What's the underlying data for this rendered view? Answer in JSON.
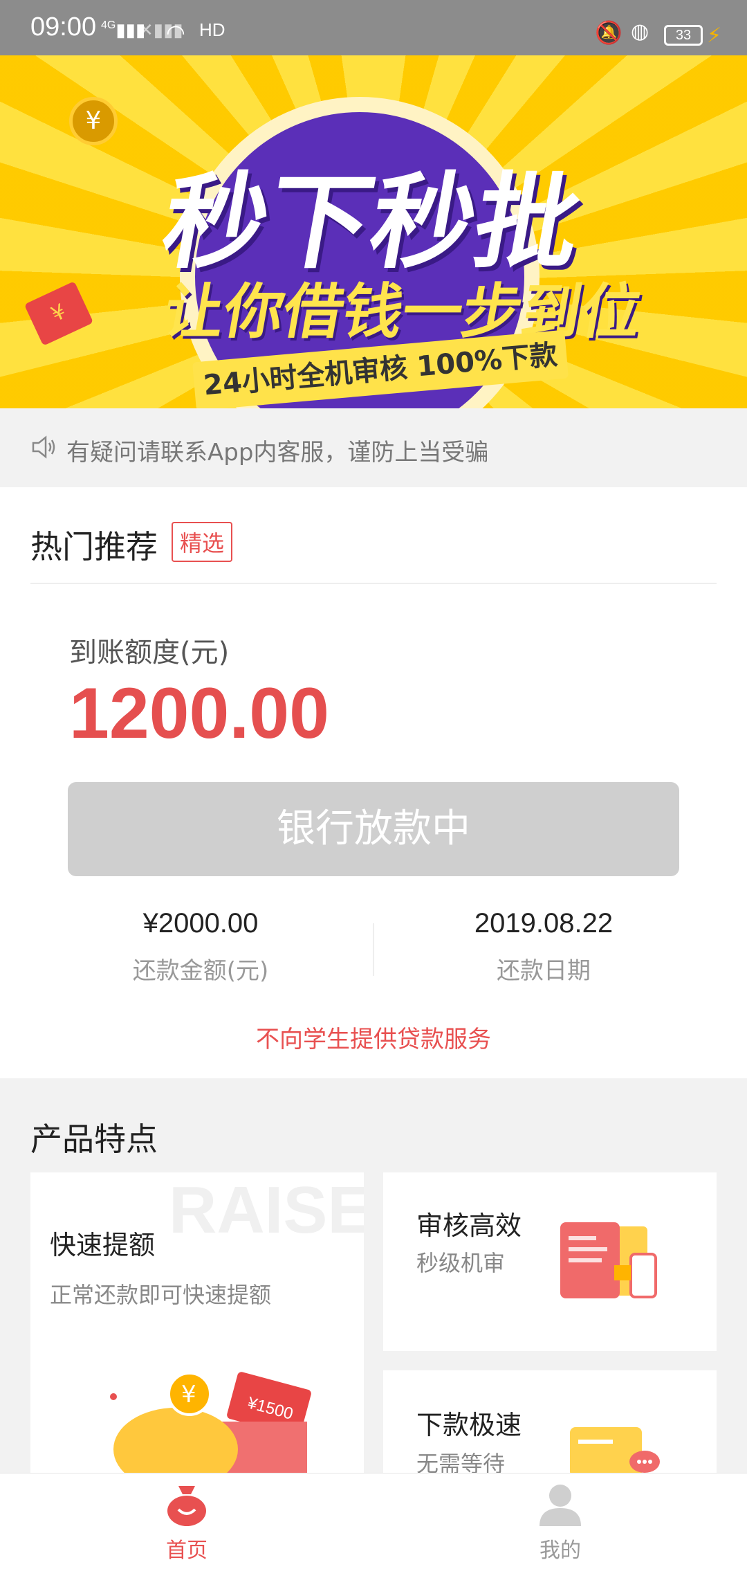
{
  "status_bar": {
    "time": "09:00",
    "network_4g": "4G",
    "hd": "HD",
    "battery": "33"
  },
  "banner": {
    "headline": "秒下秒批",
    "subline": "让你借钱一步到位",
    "ribbon": "24小时全机审核 100%下款",
    "coin_symbol": "¥",
    "envelope_symbol": "¥"
  },
  "notice": {
    "text": "有疑问请联系App内客服，谨防上当受骗",
    "icon": "speaker-icon"
  },
  "hot": {
    "heading": "热门推荐",
    "tag": "精选",
    "amount_label": "到账额度(元)",
    "amount": "1200.00",
    "button_label": "银行放款中",
    "repay_amount": "¥2000.00",
    "repay_amount_label": "还款金额(元)",
    "repay_date": "2019.08.22",
    "repay_date_label": "还款日期",
    "warning": "不向学生提供贷款服务"
  },
  "features": {
    "title": "产品特点",
    "watermark": "RAISE",
    "items": [
      {
        "name": "快速提额",
        "desc": "正常还款即可快速提额",
        "illustration_text": "¥1500",
        "illustration_symbol": "¥"
      },
      {
        "name": "审核高效",
        "desc": "秒级机审"
      },
      {
        "name": "下款极速",
        "desc": "无需等待"
      }
    ]
  },
  "nav": {
    "items": [
      {
        "label": "首页",
        "icon": "money-bag-icon",
        "active": true
      },
      {
        "label": "我的",
        "icon": "user-icon",
        "active": false
      }
    ]
  },
  "colors": {
    "accent": "#e54f4f",
    "banner_yellow": "#ffd400",
    "button_disabled": "#cfcfcf"
  }
}
